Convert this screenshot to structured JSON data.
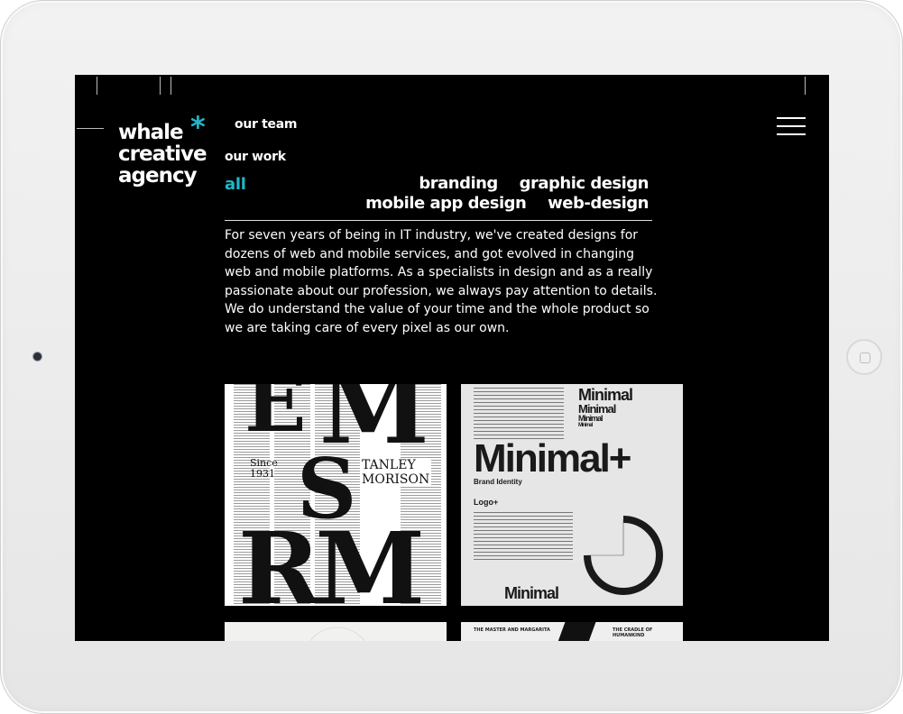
{
  "logo": {
    "line1": "whale",
    "line2": "creative",
    "line3": "agency",
    "asterisk": "*",
    "asterisk_color": "#1fb8c9"
  },
  "nav": {
    "our_team": "our team",
    "our_work": "our work",
    "all": "all",
    "accent_color": "#1fb8c9"
  },
  "filters": [
    "branding",
    "graphic design",
    "mobile app design",
    "web-design"
  ],
  "intro": "For seven years of being in IT industry, we've created designs for dozens of web and mobile services, and got evolved in changing web and mobile platforms. As a specialists in design and as a really passionate about our profession, we always pay attention to details. We do understand the value of your time and the whole product so we are taking care of every pixel as our own.",
  "menu_icon": "hamburger-icon",
  "portfolio": {
    "tile1": {
      "since": "Since",
      "year": "1931",
      "name1": "TANLEY",
      "name2": "MORISON"
    },
    "tile2": {
      "minimal_lines": [
        "Minimal",
        "Minimal",
        "Minimal",
        "Minimal"
      ],
      "headline": "Minimal+",
      "sub": "Brand Identity",
      "logo_label": "Logo+",
      "footer": "Minimal"
    },
    "tile4": {
      "left": "THE MASTER AND MARGARITA",
      "right": "THE CRADLE OF HUMANKIND"
    }
  }
}
